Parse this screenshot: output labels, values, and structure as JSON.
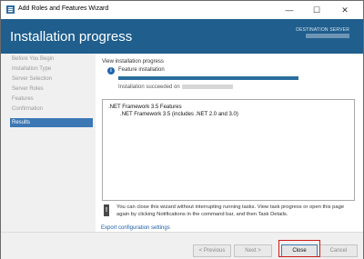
{
  "window": {
    "title": "Add Roles and Features Wizard",
    "minimize": "—",
    "maximize": "☐",
    "close": "✕"
  },
  "header": {
    "title": "Installation progress",
    "destination_label": "DESTINATION SERVER"
  },
  "sidebar": {
    "items": [
      {
        "label": "Before You Begin",
        "active": false
      },
      {
        "label": "Installation Type",
        "active": false
      },
      {
        "label": "Server Selection",
        "active": false
      },
      {
        "label": "Server Roles",
        "active": false
      },
      {
        "label": "Features",
        "active": false
      },
      {
        "label": "Confirmation",
        "active": false
      },
      {
        "label": "Results",
        "active": true
      }
    ]
  },
  "main": {
    "section_label": "View installation progress",
    "feature_title": "Feature installation",
    "progress_fraction": 1.0,
    "success_text": "Installation succeeded on",
    "results": [
      ".NET Framework 3.5 Features",
      ".NET Framework 3.5 (includes .NET 2.0 and 3.0)"
    ],
    "note": "You can close this wizard without interrupting running tasks. View task progress or open this page again by clicking Notifications in the command bar, and then Task Details.",
    "export_link": "Export configuration settings"
  },
  "footer": {
    "previous": "< Previous",
    "next": "Next >",
    "close": "Close",
    "cancel": "Cancel"
  },
  "colors": {
    "header_bg": "#1f5e8d",
    "active_nav": "#3c78b4",
    "progress_fill": "#2a6e9e",
    "link": "#1e5fa8",
    "highlight": "#cc1a1a"
  }
}
